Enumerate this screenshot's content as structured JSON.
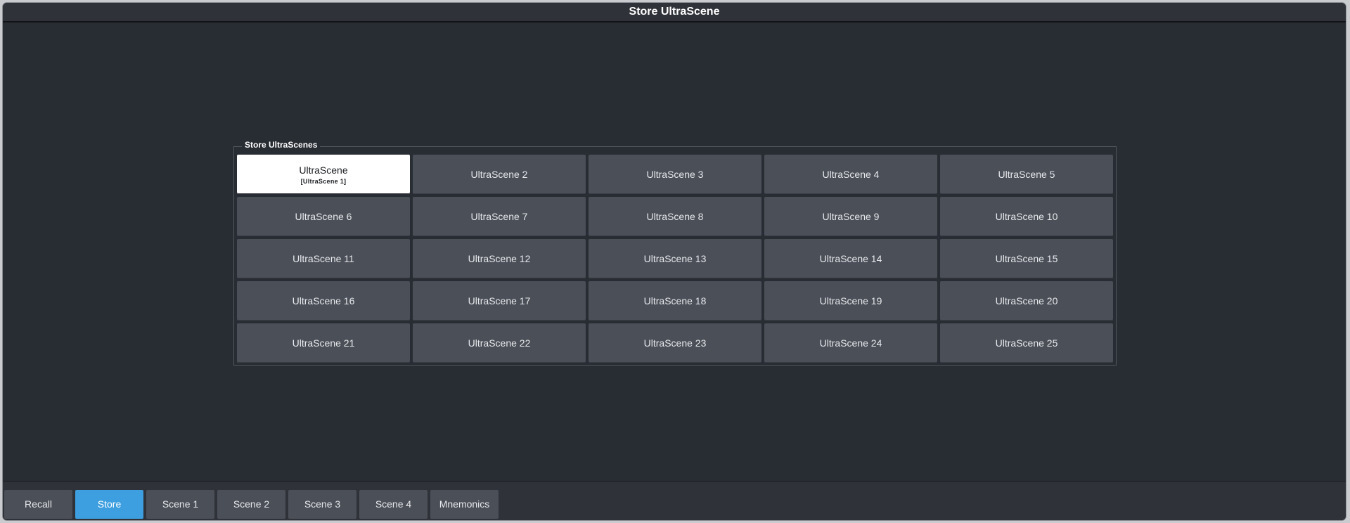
{
  "window": {
    "title": "Store UltraScene"
  },
  "panel": {
    "title": "Store UltraScenes",
    "scenes": [
      {
        "label": "UltraScene",
        "sub": "[UltraScene 1]",
        "active": true
      },
      {
        "label": "UltraScene 2",
        "sub": ""
      },
      {
        "label": "UltraScene 3",
        "sub": ""
      },
      {
        "label": "UltraScene 4",
        "sub": ""
      },
      {
        "label": "UltraScene 5",
        "sub": ""
      },
      {
        "label": "UltraScene 6",
        "sub": ""
      },
      {
        "label": "UltraScene 7",
        "sub": ""
      },
      {
        "label": "UltraScene 8",
        "sub": ""
      },
      {
        "label": "UltraScene 9",
        "sub": ""
      },
      {
        "label": "UltraScene 10",
        "sub": ""
      },
      {
        "label": "UltraScene 11",
        "sub": ""
      },
      {
        "label": "UltraScene 12",
        "sub": ""
      },
      {
        "label": "UltraScene 13",
        "sub": ""
      },
      {
        "label": "UltraScene 14",
        "sub": ""
      },
      {
        "label": "UltraScene 15",
        "sub": ""
      },
      {
        "label": "UltraScene 16",
        "sub": ""
      },
      {
        "label": "UltraScene 17",
        "sub": ""
      },
      {
        "label": "UltraScene 18",
        "sub": ""
      },
      {
        "label": "UltraScene 19",
        "sub": ""
      },
      {
        "label": "UltraScene 20",
        "sub": ""
      },
      {
        "label": "UltraScene 21",
        "sub": ""
      },
      {
        "label": "UltraScene 22",
        "sub": ""
      },
      {
        "label": "UltraScene 23",
        "sub": ""
      },
      {
        "label": "UltraScene 24",
        "sub": ""
      },
      {
        "label": "UltraScene 25",
        "sub": ""
      }
    ]
  },
  "tabs": [
    {
      "label": "Recall",
      "selected": false
    },
    {
      "label": "Store",
      "selected": true
    },
    {
      "label": "Scene 1",
      "selected": false
    },
    {
      "label": "Scene 2",
      "selected": false
    },
    {
      "label": "Scene 3",
      "selected": false
    },
    {
      "label": "Scene 4",
      "selected": false
    },
    {
      "label": "Mnemonics",
      "selected": false
    }
  ],
  "colors": {
    "background": "#282c33",
    "button": "#4b4f58",
    "active_button": "#ffffff",
    "selected_tab": "#3d9fe0"
  }
}
